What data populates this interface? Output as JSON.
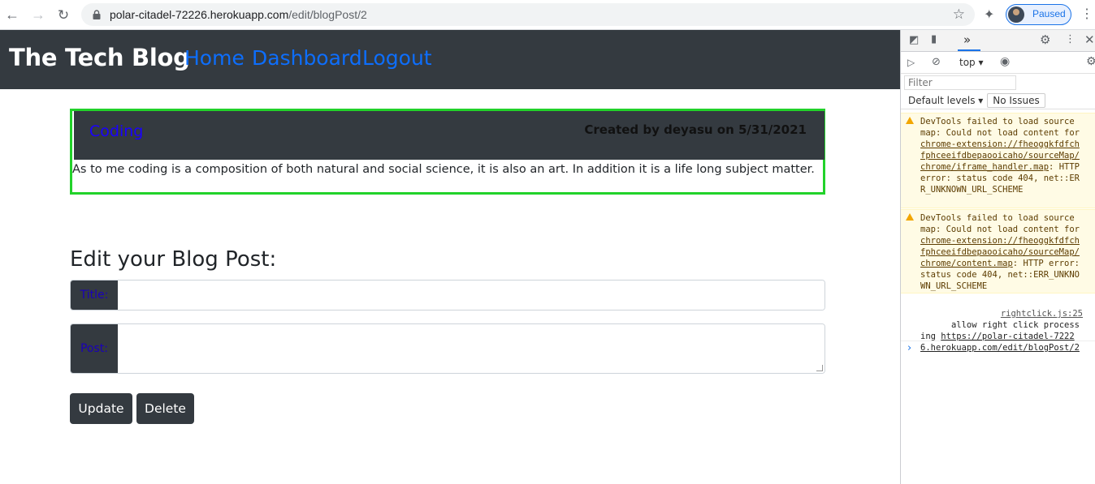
{
  "browser": {
    "url_host": "polar-citadel-72226.herokuapp.com",
    "url_path": "/edit/blogPost/2",
    "profile_status": "Paused"
  },
  "navbar": {
    "brand": "The Tech Blog",
    "links": [
      "Home",
      "Dashboard",
      "Logout"
    ]
  },
  "post": {
    "title": "Coding",
    "meta": "Created by deyasu on 5/31/2021",
    "body": "As to me coding is a composition of both natural and social science, it is also an art. In addition it is a life long subject matter."
  },
  "edit_form": {
    "heading": "Edit your Blog Post:",
    "title_label": "Title:",
    "post_label": "Post:",
    "update_label": "Update",
    "delete_label": "Delete"
  },
  "devtools": {
    "context": "top",
    "filter_placeholder": "Filter",
    "levels": "Default levels",
    "issues": "No Issues",
    "warning1": {
      "pre": "DevTools failed to load source map: Could not load content for ",
      "link": "chrome-extension://fheoggkfdfchfphceeifdbepaooicaho/sourceMap/chrome/iframe_handler.map",
      "post": ": HTTP error: status code 404, net::ERR_UNKNOWN_URL_SCHEME"
    },
    "warning2": {
      "pre": "DevTools failed to load source map: Could not load content for ",
      "link": "chrome-extension://fheoggkfdfchfphceeifdbepaooicaho/sourceMap/chrome/content.map",
      "post": ": HTTP error: status code 404, net::ERR_UNKNOWN_URL_SCHEME"
    },
    "log": {
      "text": "allow right click processing ",
      "source": "rightclick.js:25",
      "link": "https://polar-citadel-72226.herokuapp.com/edit/blogPost/2"
    }
  },
  "colors": {
    "navbar_bg": "#343a40",
    "link_blue": "#0d6efd",
    "card_border": "#22d22a",
    "post_title": "#1a00ff"
  }
}
